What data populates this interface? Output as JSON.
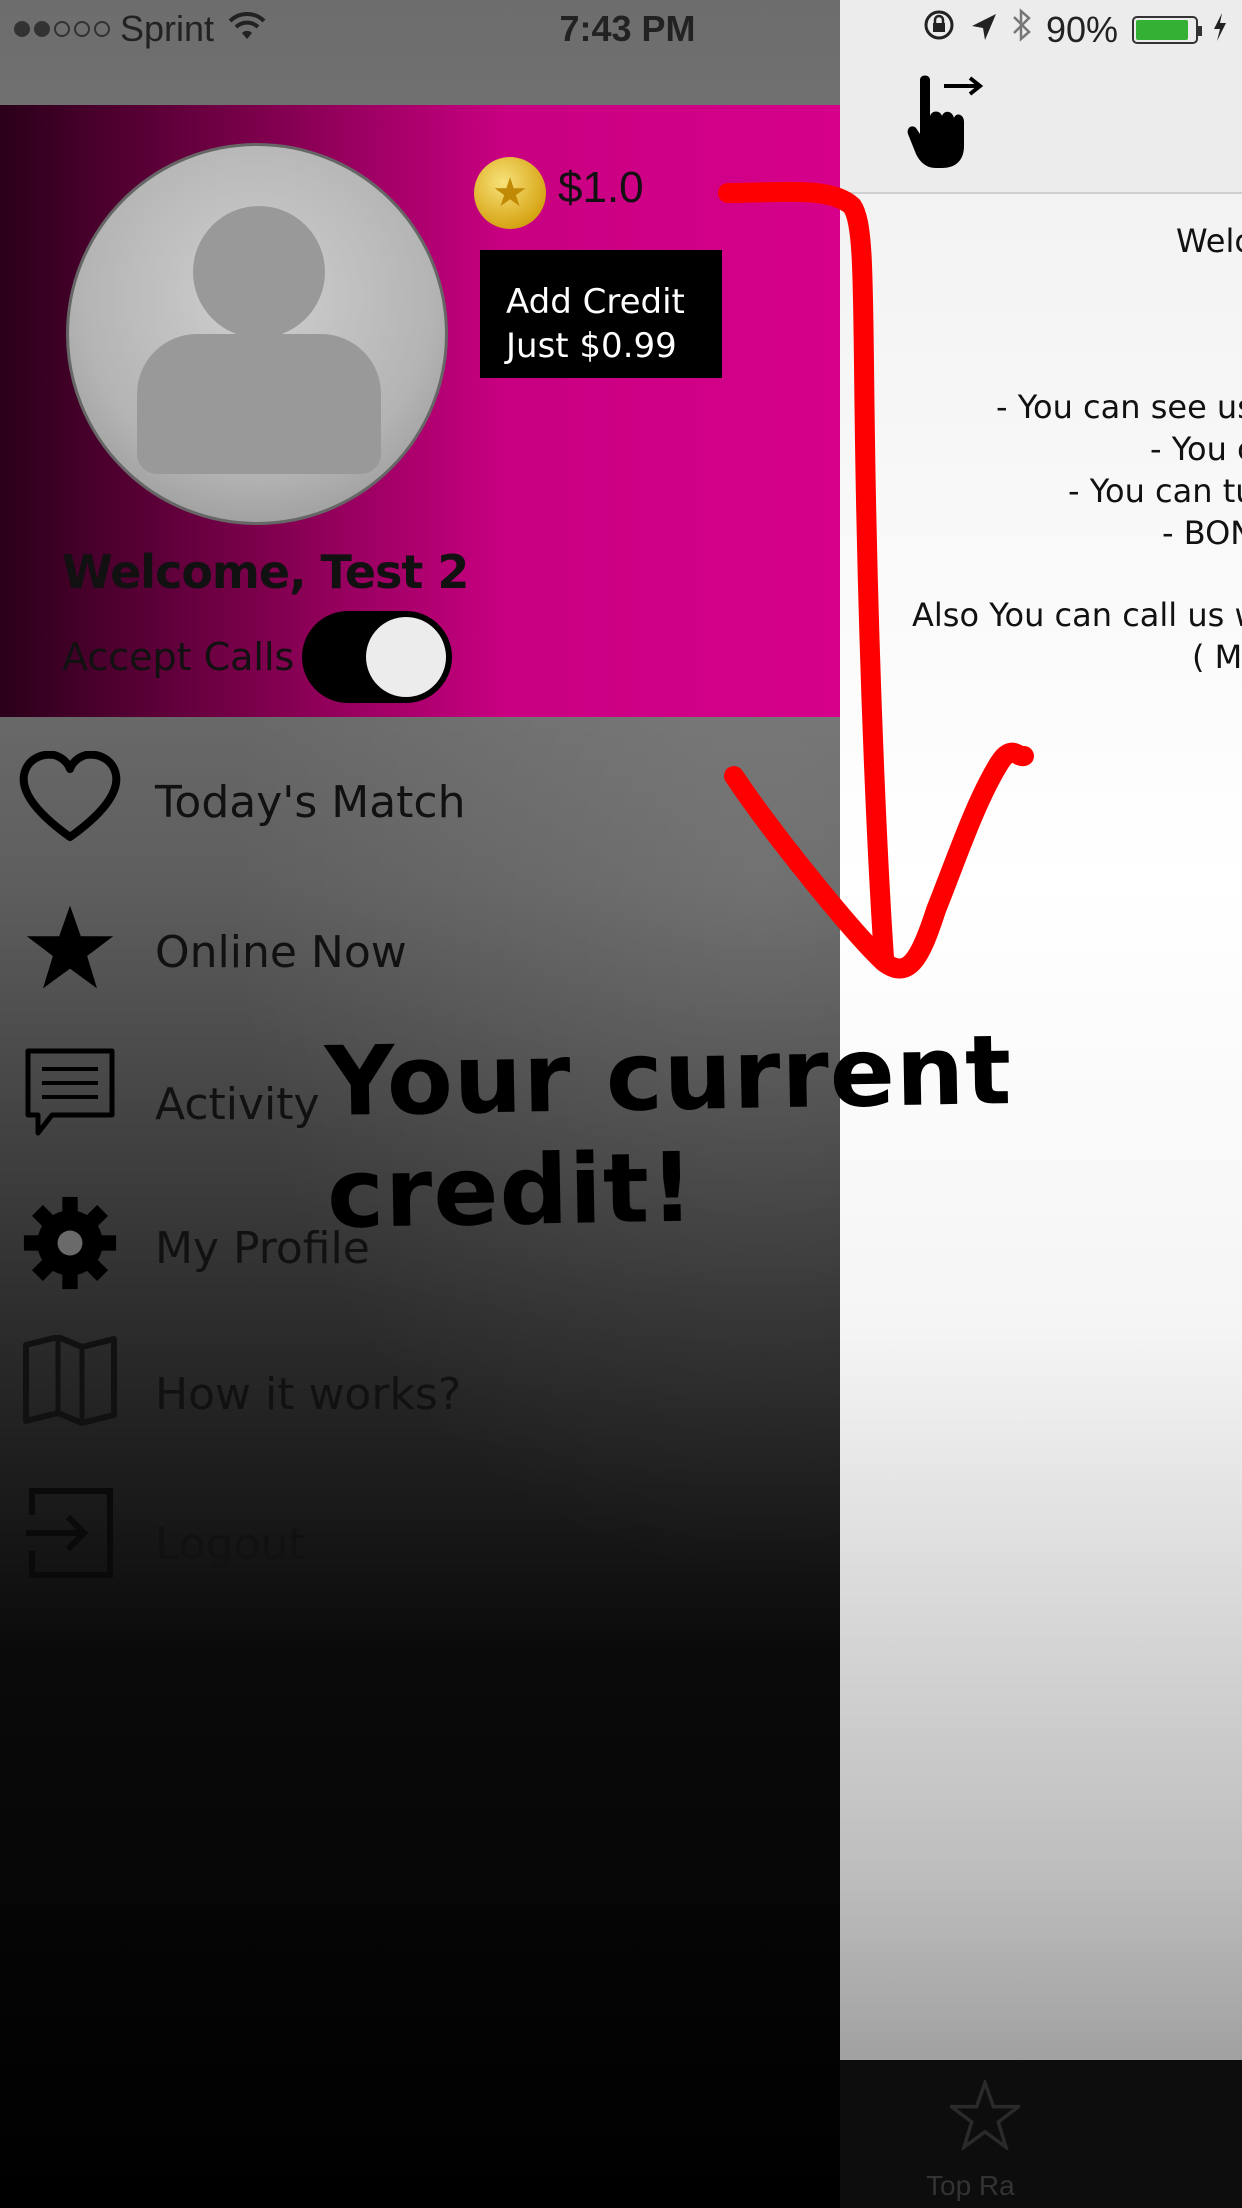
{
  "status_bar": {
    "carrier": "Sprint",
    "time": "7:43 PM",
    "battery": "90%",
    "battery_level": 0.9
  },
  "drawer": {
    "credit_amount": "$1.0",
    "add_credit_line1": "Add Credit",
    "add_credit_line2": "Just $0.99",
    "welcome": "Welcome, Test 2",
    "accept_calls_label": "Accept Calls",
    "accept_calls_on": true,
    "menu": [
      {
        "label": "Today's Match",
        "icon": "heart-icon"
      },
      {
        "label": "Online Now",
        "icon": "star-icon"
      },
      {
        "label": "Activity",
        "icon": "chat-bubble-icon"
      },
      {
        "label": "My Profile",
        "icon": "gear-icon"
      },
      {
        "label": "How it works?",
        "icon": "book-icon"
      },
      {
        "label": "Logout",
        "icon": "logout-icon"
      }
    ]
  },
  "content": {
    "lines": [
      "Welc",
      "- You can see use",
      "- You c",
      "- You can tur",
      "- BON",
      "Also You can call us wit",
      "( M"
    ],
    "tab_label": "Top Ra"
  },
  "annotation": {
    "text": "Your current credit!",
    "color": "#ff0000"
  }
}
